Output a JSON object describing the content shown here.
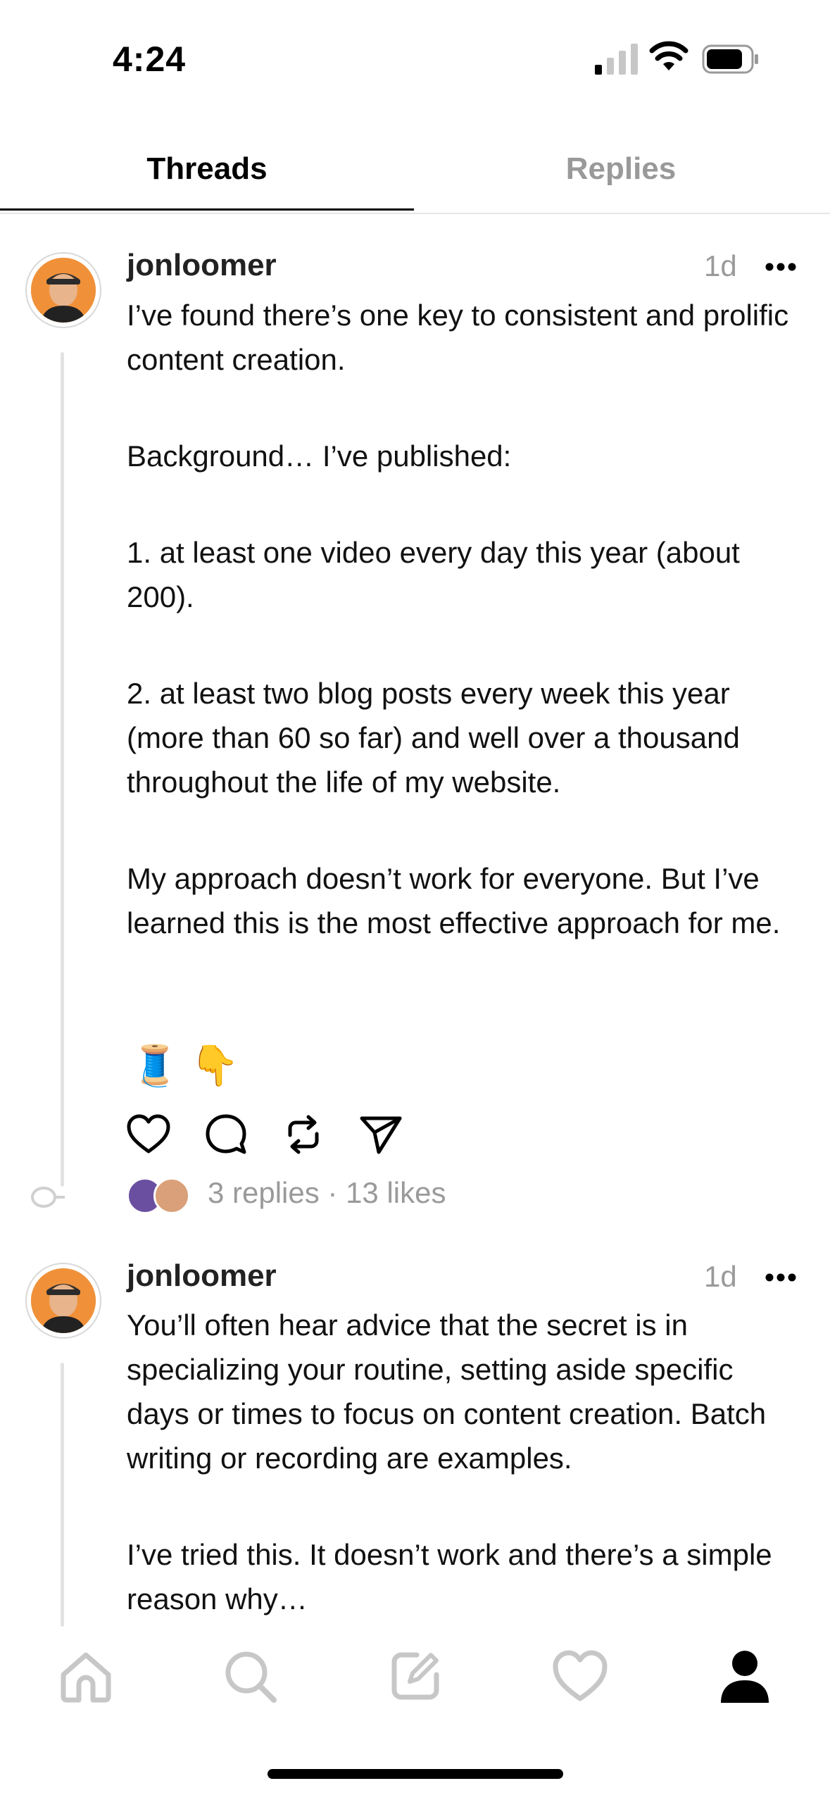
{
  "status_bar": {
    "time": "4:24"
  },
  "tabs": [
    {
      "label": "Threads",
      "active": true
    },
    {
      "label": "Replies",
      "active": false
    }
  ],
  "posts": [
    {
      "username": "jonloomer",
      "time": "1d",
      "paragraphs": [
        "I’ve found there’s one key to consistent and prolific content creation.",
        "Background… I’ve published:",
        "1. at least one video every day this year (about 200).",
        "2. at least two blog posts every week this year (more than 60 so far) and well over a thousand throughout the life of my website.",
        "My approach doesn’t work for everyone. But I’ve learned this is the most effective approach for me."
      ],
      "emojis": "🧵 👇",
      "stats": "3 replies · 13 likes"
    },
    {
      "username": "jonloomer",
      "time": "1d",
      "paragraphs": [
        "You’ll often hear advice that the secret is in specializing your routine, setting aside specific days or times to focus on content creation. Batch writing or recording are examples.",
        "I’ve tried this. It doesn’t work and there’s a simple reason why…"
      ]
    }
  ],
  "bottom_nav": [
    "home-icon",
    "search-icon",
    "compose-icon",
    "heart-icon",
    "profile-icon"
  ]
}
